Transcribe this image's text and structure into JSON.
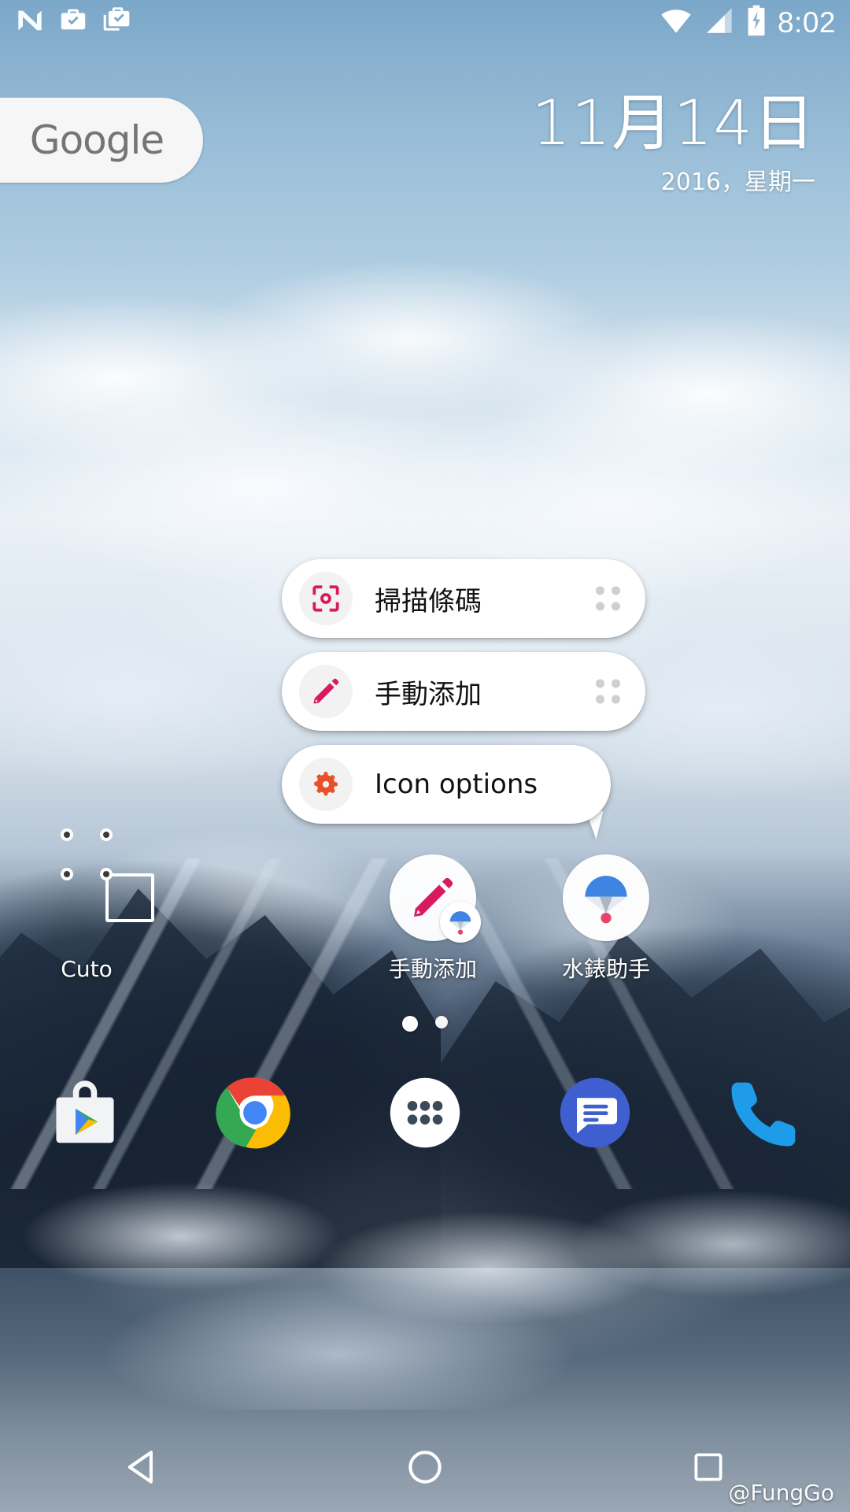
{
  "status_bar": {
    "time": "8:02",
    "left_icons": [
      "android-n-icon",
      "work-briefcase-check-icon",
      "work-briefcase-copy-check-icon"
    ],
    "right_icons": [
      "wifi-icon",
      "cellular-signal-icon",
      "battery-charging-icon"
    ]
  },
  "search_widget": {
    "label": "Google",
    "icon": "google-logo"
  },
  "date_widget": {
    "date": "11月14日",
    "subtitle": "2016，星期一"
  },
  "popup_menu": {
    "items": [
      {
        "label": "掃描條碼",
        "icon": "barcode-scan-icon",
        "icon_color": "#d81b60",
        "has_drag_handle": true
      },
      {
        "label": "手動添加",
        "icon": "pencil-edit-icon",
        "icon_color": "#d81b60",
        "has_drag_handle": true
      },
      {
        "label": "Icon options",
        "icon": "gear-settings-icon",
        "icon_color": "#e8502a",
        "has_drag_handle": false
      }
    ]
  },
  "home_apps": [
    {
      "label": "Cuto",
      "icon": "cuto-app-icon"
    },
    {
      "label": "手動添加",
      "icon": "pencil-shortcut-icon",
      "badge": "parachute-badge-icon"
    },
    {
      "label": "水錶助手",
      "icon": "parachute-app-icon"
    }
  ],
  "page_indicator": {
    "pages": 2,
    "current": 1
  },
  "dock": [
    {
      "label": "Play Store",
      "icon": "play-store-icon"
    },
    {
      "label": "Chrome",
      "icon": "chrome-icon"
    },
    {
      "label": "All Apps",
      "icon": "app-drawer-icon"
    },
    {
      "label": "Messages",
      "icon": "messages-icon"
    },
    {
      "label": "Phone",
      "icon": "phone-icon"
    }
  ],
  "nav_bar": [
    {
      "label": "Back",
      "icon": "back-triangle-icon"
    },
    {
      "label": "Home",
      "icon": "home-circle-icon"
    },
    {
      "label": "Recents",
      "icon": "recents-square-icon"
    }
  ],
  "watermark": "@FungGo",
  "colors": {
    "accent_pink": "#d81b60",
    "accent_orange": "#e8502a",
    "popup_bg": "#ffffff",
    "popup_icon_bg": "#f2f2f2"
  }
}
